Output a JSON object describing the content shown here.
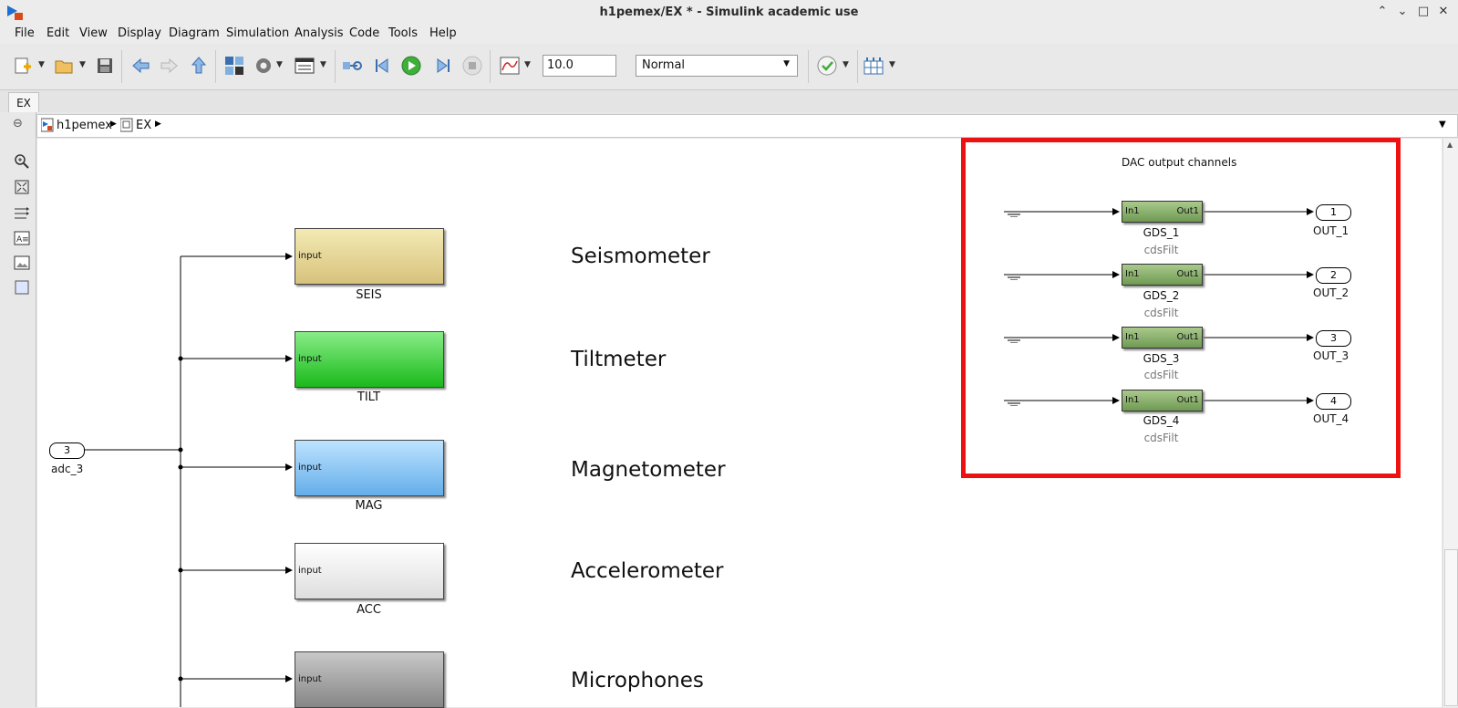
{
  "window": {
    "title": "h1pemex/EX * - Simulink academic use",
    "controls": [
      "⌃",
      "⌄",
      "□",
      "✕"
    ]
  },
  "menu": [
    "File",
    "Edit",
    "View",
    "Display",
    "Diagram",
    "Simulation",
    "Analysis",
    "Code",
    "Tools",
    "Help"
  ],
  "toolbar": {
    "stop_time": "10.0",
    "sim_mode": "Normal"
  },
  "tabs": [
    {
      "label": "EX"
    }
  ],
  "breadcrumb": [
    "h1pemex",
    "EX"
  ],
  "diagram": {
    "inport": {
      "number": "3",
      "name": "adc_3"
    },
    "subsystems": [
      {
        "name": "SEIS",
        "port": "input",
        "color_top": "#f3eab4",
        "color_bottom": "#d7c27c",
        "desc": "Seismometer"
      },
      {
        "name": "TILT",
        "port": "input",
        "color_top": "#88ec88",
        "color_bottom": "#1aba1a",
        "desc": "Tiltmeter"
      },
      {
        "name": "MAG",
        "port": "input",
        "color_top": "#bde3ff",
        "color_bottom": "#64aeea",
        "desc": "Magnetometer"
      },
      {
        "name": "ACC",
        "port": "input",
        "color_top": "#ffffff",
        "color_bottom": "#dedede",
        "desc": "Accelerometer"
      },
      {
        "name": "",
        "port": "input",
        "color_top": "#c8c8c8",
        "color_bottom": "#868686",
        "desc": "Microphones"
      }
    ],
    "dac": {
      "title": "DAC output channels",
      "channels": [
        {
          "block": "GDS_1",
          "lib": "cdsFilt",
          "in": "In1",
          "out": "Out1",
          "port_num": "1",
          "port_name": "OUT_1"
        },
        {
          "block": "GDS_2",
          "lib": "cdsFilt",
          "in": "In1",
          "out": "Out1",
          "port_num": "2",
          "port_name": "OUT_2"
        },
        {
          "block": "GDS_3",
          "lib": "cdsFilt",
          "in": "In1",
          "out": "Out1",
          "port_num": "3",
          "port_name": "OUT_3"
        },
        {
          "block": "GDS_4",
          "lib": "cdsFilt",
          "in": "In1",
          "out": "Out1",
          "port_num": "4",
          "port_name": "OUT_4"
        }
      ],
      "highlight_color": "#ee1111"
    }
  }
}
